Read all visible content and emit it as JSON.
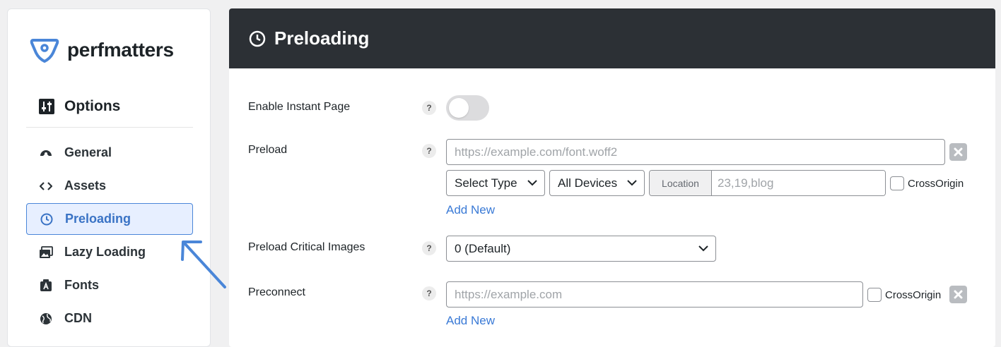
{
  "brand": {
    "name": "perfmatters",
    "logo_icon": "perfmatters-logo-icon"
  },
  "sidebar": {
    "section_title": "Options",
    "items": [
      {
        "label": "General",
        "icon": "gauge-icon",
        "active": false
      },
      {
        "label": "Assets",
        "icon": "code-icon",
        "active": false
      },
      {
        "label": "Preloading",
        "icon": "clock-icon",
        "active": true
      },
      {
        "label": "Lazy Loading",
        "icon": "images-icon",
        "active": false
      },
      {
        "label": "Fonts",
        "icon": "font-icon",
        "active": false
      },
      {
        "label": "CDN",
        "icon": "globe-icon",
        "active": false
      }
    ]
  },
  "page": {
    "title": "Preloading",
    "icon": "clock-icon"
  },
  "settings": {
    "instant_page": {
      "label": "Enable Instant Page",
      "help": "?",
      "enabled": false
    },
    "preload": {
      "label": "Preload",
      "help": "?",
      "url_placeholder": "https://example.com/font.woff2",
      "type_select": "Select Type",
      "device_select": "All Devices",
      "location_label": "Location",
      "location_placeholder": "23,19,blog",
      "crossorigin_label": "CrossOrigin",
      "add_new": "Add New"
    },
    "critical_images": {
      "label": "Preload Critical Images",
      "help": "?",
      "value": "0 (Default)"
    },
    "preconnect": {
      "label": "Preconnect",
      "help": "?",
      "url_placeholder": "https://example.com",
      "crossorigin_label": "CrossOrigin",
      "add_new": "Add New"
    }
  },
  "colors": {
    "accent": "#3a73c5",
    "header_bg": "#2c3035",
    "active_bg": "#e7efff",
    "arrow": "#4a86d8"
  }
}
